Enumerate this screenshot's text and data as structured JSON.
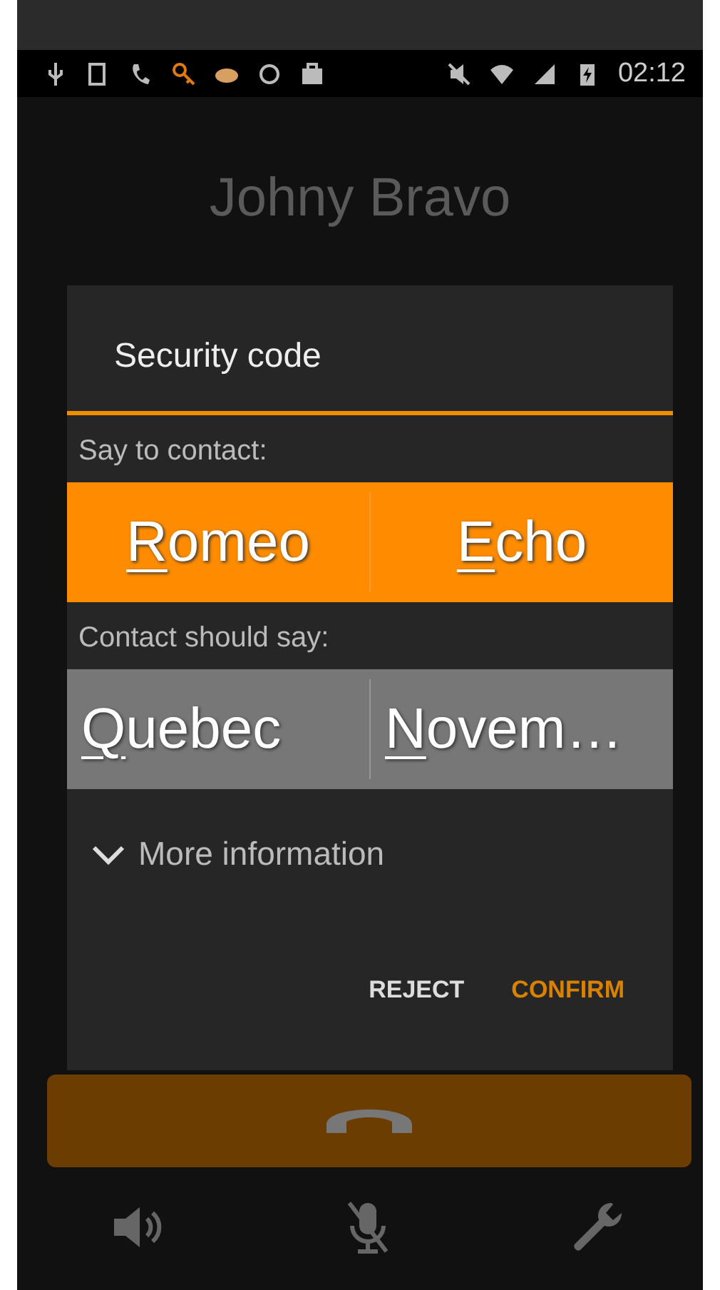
{
  "status_bar": {
    "time": "02:12"
  },
  "contact": {
    "name": "Johny Bravo"
  },
  "dialog": {
    "title": "Security code",
    "say_label": "Say to contact:",
    "say_words": [
      "Romeo",
      "Echo"
    ],
    "hear_label": "Contact should say:",
    "hear_words": [
      "Quebec",
      "Novem…"
    ],
    "more_info": {
      "label": "More information",
      "expanded": false
    },
    "buttons": [
      {
        "label": "REJECT",
        "kind": "neutral"
      },
      {
        "label": "CONFIRM",
        "kind": "primary"
      }
    ]
  }
}
